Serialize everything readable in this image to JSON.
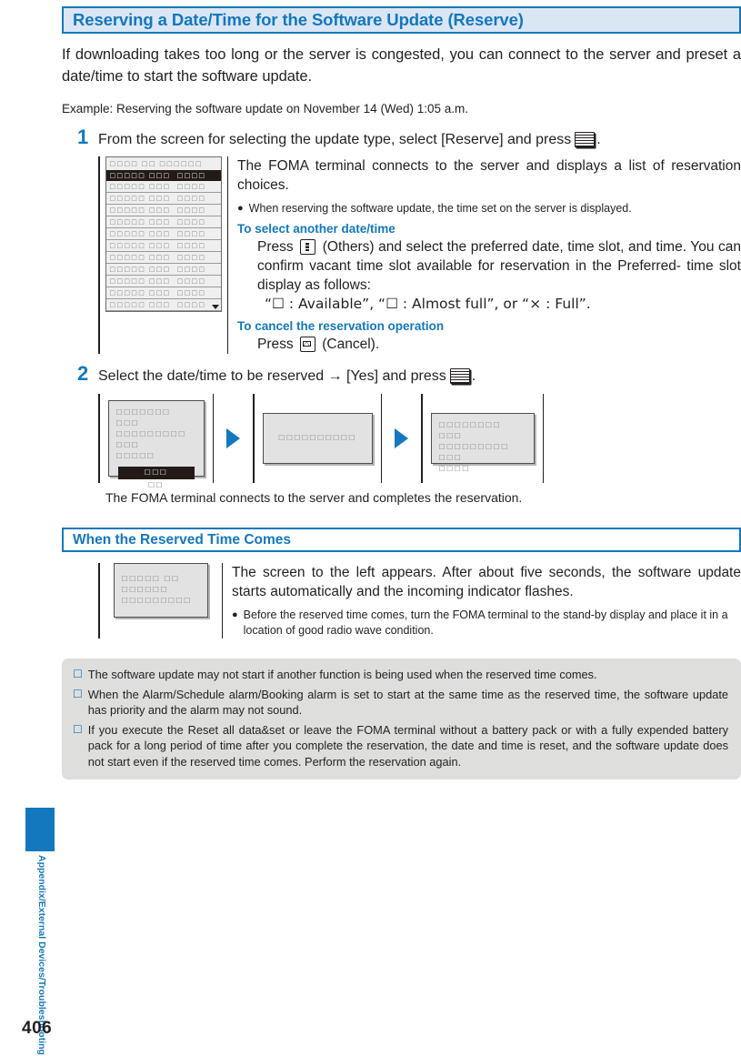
{
  "page": {
    "folio": "406",
    "running_head": "Appendix/External Devices/Troubleshooting"
  },
  "chapter": {
    "title": "Reserving a Date/Time for the Software Update (Reserve)"
  },
  "intro": {
    "lead": "If downloading takes too long or the server is congested, you can connect to the server and preset a date/time to start the software update.",
    "example": "Example: Reserving the software update on November 14 (Wed) 1:05 a.m."
  },
  "steps": [
    {
      "number": "1",
      "head_before_icon": "From the screen for selecting the update type, select [Reserve] and press",
      "head_icon": "select-key-icon",
      "head_after_icon": ".",
      "explanation": "The FOMA terminal connects to the server and displays a list of reservation choices.",
      "bullet": "When reserving the software update, the time set on the server is displayed.",
      "subsections": [
        {
          "heading": "To select another date/time",
          "line1_before_icon": "Press",
          "line1_icon": "others-key-icon",
          "line1_after_icon": "(Others) and select the preferred date, time slot, and time. You can confirm vacant time slot available for reservation in the Preferred- time slot display as follows:",
          "line2": "“☐ : Available”, “☐ : Almost full”, or “× : Full”."
        },
        {
          "heading": "To cancel the reservation operation",
          "line1_before_icon": "Press",
          "line1_icon": "mail-key-icon",
          "line1_after_icon": "(Cancel)."
        }
      ],
      "phone_screen": {
        "titlebar": "☐☐☐☐ ☐☐ ☐☐☐☐☐☐",
        "rows": [
          "☐☐☐☐☐ ☐☐☐  ☐☐☐☐",
          "☐☐☐☐☐ ☐☐☐  ☐☐☐☐",
          "☐☐☐☐☐ ☐☐☐  ☐☐☐☐",
          "☐☐☐☐☐ ☐☐☐  ☐☐☐☐",
          "☐☐☐☐☐ ☐☐☐  ☐☐☐☐",
          "☐☐☐☐☐ ☐☐☐  ☐☐☐☐",
          "☐☐☐☐☐ ☐☐☐  ☐☐☐☐",
          "☐☐☐☐☐ ☐☐☐  ☐☐☐☐",
          "☐☐☐☐☐ ☐☐☐  ☐☐☐☐",
          "☐☐☐☐☐ ☐☐☐  ☐☐☐☐",
          "☐☐☐☐☐ ☐☐☐  ☐☐☐☐",
          "☐☐☐☐☐ ☐☐☐  ☐☐☐☐"
        ],
        "selected_index": 0
      }
    },
    {
      "number": "2",
      "head_before_icon": "Select the date/time to be reserved → [Yes] and press",
      "head_icon": "select-key-icon",
      "head_after_icon": ".",
      "flow": {
        "screen1": {
          "line1": "☐☐☐☐☐☐☐ ☐☐☐",
          "line2": "☐☐☐☐☐☐☐☐☐ ☐☐☐",
          "line3": "☐☐☐☐☐",
          "yes": "☐☐☐",
          "no": "☐☐"
        },
        "screen2": {
          "line1": "☐☐☐☐☐☐☐☐☐☐"
        },
        "screen3": {
          "line1": "☐☐☐☐☐☐☐☐ ☐☐☐",
          "line2": "☐☐☐☐☐☐☐☐☐ ☐☐☐",
          "line3": "☐☐☐☐"
        },
        "arrow1": "flow-arrow-icon",
        "arrow2": "flow-arrow-icon"
      },
      "caption": "The FOMA terminal connects to the server and completes the reservation."
    }
  ],
  "section": {
    "title": "When the Reserved Time Comes",
    "explanation": "The screen to the left appears. After about five seconds, the software update starts automatically and the incoming indicator flashes.",
    "bullet": "Before the reserved time comes, turn the FOMA terminal to the stand-by display and place it in a location of good radio wave condition.",
    "phone_screen": {
      "line1": "☐☐☐☐☐ ☐☐ ☐☐☐☐☐☐",
      "line2": "☐☐☐☐☐☐☐☐☐"
    }
  },
  "notes": {
    "marker": "☐",
    "items": [
      "The software update may not start if another function is being used when the reserved time comes.",
      "When the Alarm/Schedule alarm/Booking alarm is set to start at the same time as the reserved time, the software update has priority and the alarm may not sound.",
      "If you execute the Reset all data&set or leave the FOMA terminal without a battery pack or with a fully expended battery pack for a long period of time after you complete the reservation, the date and time is reset, and the software update does not start even if the reserved time comes. Perform the reservation again."
    ]
  },
  "colors": {
    "accent_blue": "#1378be",
    "chapter_bar_fill": "#dbe6f4",
    "notes_fill": "#dededd"
  }
}
